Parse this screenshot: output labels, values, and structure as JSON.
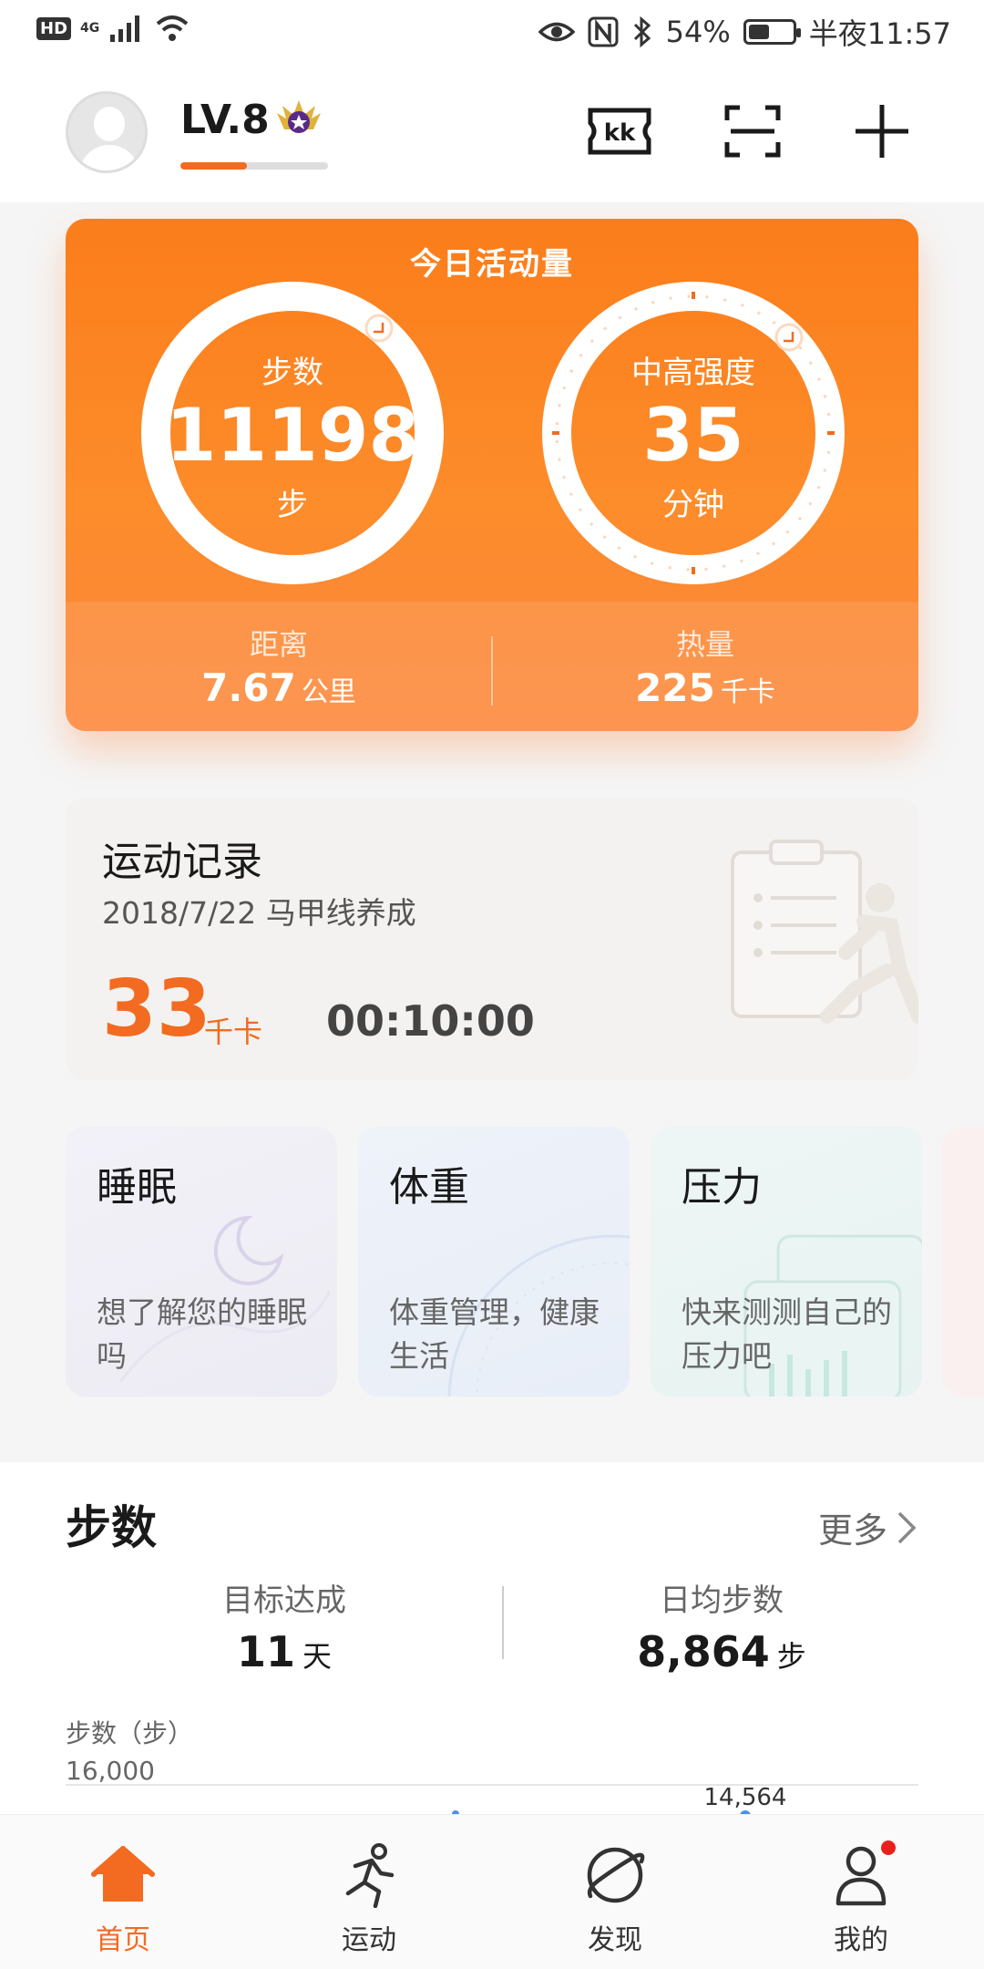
{
  "status_bar": {
    "hd": "HD",
    "network": "4G",
    "battery": "54%",
    "battery_level": 0.54,
    "time": "半夜11:57"
  },
  "header": {
    "level": "LV.8",
    "level_progress": 0.45,
    "icons": [
      "kk-card-icon",
      "scan-icon",
      "add-icon"
    ]
  },
  "activity": {
    "title": "今日活动量",
    "steps_label": "步数",
    "steps_value": "11198",
    "steps_unit": "步",
    "intensity_label": "中高强度",
    "intensity_value": "35",
    "intensity_unit": "分钟",
    "distance_label": "距离",
    "distance_value": "7.67",
    "distance_unit": "公里",
    "calories_label": "热量",
    "calories_value": "225",
    "calories_unit": "千卡"
  },
  "record": {
    "title": "运动记录",
    "subtitle": "2018/7/22  马甲线养成",
    "calories": "33",
    "calories_unit": "千卡",
    "duration": "00:10:00"
  },
  "cards": [
    {
      "title": "睡眠",
      "desc": "想了解您的睡眠吗"
    },
    {
      "title": "体重",
      "desc": "体重管理，健康生活"
    },
    {
      "title": "压力",
      "desc": "快来测测自己的压力吧"
    }
  ],
  "steps_section": {
    "title": "步数",
    "more": "更多",
    "goal_label": "目标达成",
    "goal_value": "11",
    "goal_unit": "天",
    "avg_label": "日均步数",
    "avg_value": "8,864",
    "avg_unit": "步",
    "axis_label": "步数（步）",
    "axis_tick": "16,000",
    "peak_label": "14,564"
  },
  "nav": [
    {
      "label": "首页",
      "icon": "home-icon",
      "active": true
    },
    {
      "label": "运动",
      "icon": "running-icon",
      "active": false
    },
    {
      "label": "发现",
      "icon": "discover-icon",
      "active": false
    },
    {
      "label": "我的",
      "icon": "profile-icon",
      "active": false
    }
  ],
  "colors": {
    "accent": "#f26b21",
    "card_orange": "#fb7d1b",
    "notification_dot": "#e8201c"
  }
}
